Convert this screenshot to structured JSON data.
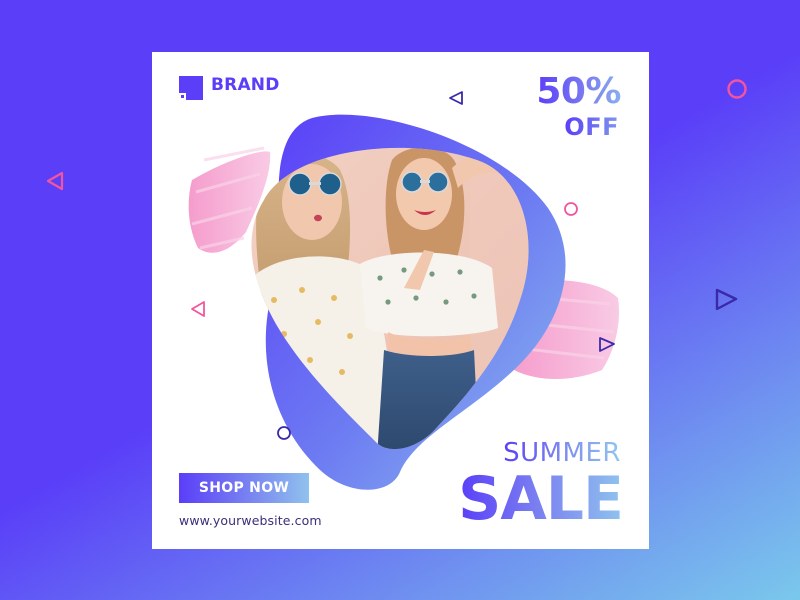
{
  "brand": {
    "name": "BRAND",
    "logo_icon": "square-logo-icon",
    "color": "#5a3ef8"
  },
  "offer": {
    "percent": "50%",
    "suffix": "OFF"
  },
  "headline": {
    "line1": "SUMMER",
    "line2": "SALE"
  },
  "cta": {
    "label": "SHOP NOW"
  },
  "footer": {
    "website": "www.yourwebsite.com"
  },
  "photo": {
    "subject_icon": "two-women-sunglasses-photo"
  },
  "colors": {
    "background": "#5a3ef8",
    "accent_pink": "#f2559f",
    "accent_purple": "#6a3fc8",
    "gradient_light": "#8fc3ee",
    "card": "#ffffff"
  },
  "decorations": {
    "triangle_icon": "triangle-outline-icon",
    "circle_icon": "circle-outline-icon"
  }
}
